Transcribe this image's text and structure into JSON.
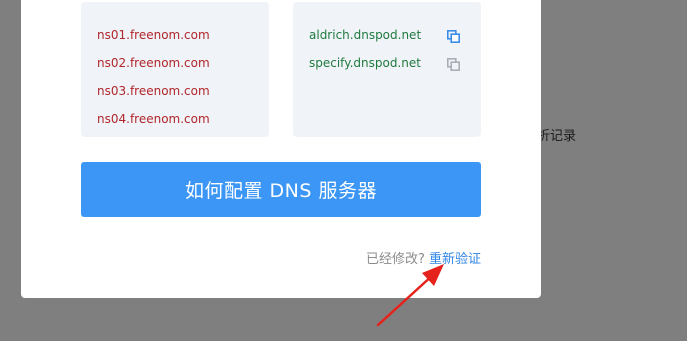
{
  "background": {
    "partial_text": "折记录"
  },
  "nameservers": {
    "current": [
      "ns01.freenom.com",
      "ns02.freenom.com",
      "ns03.freenom.com",
      "ns04.freenom.com"
    ],
    "target": [
      "aldrich.dnspod.net",
      "specify.dnspod.net"
    ]
  },
  "actions": {
    "how_to_configure_label": "如何配置 DNS 服务器",
    "modified_question": "已经修改?",
    "reverify_label": "重新验证"
  },
  "icons": {
    "copy_active": "copy-icon",
    "copy_inactive": "copy-icon"
  },
  "colors": {
    "primary": "#3b96f5",
    "link": "#2f86e6",
    "old_ns": "#b0262a",
    "new_ns": "#1f7a3f",
    "panel_bg": "#f0f3f8",
    "annotation_arrow": "#e5231c"
  }
}
